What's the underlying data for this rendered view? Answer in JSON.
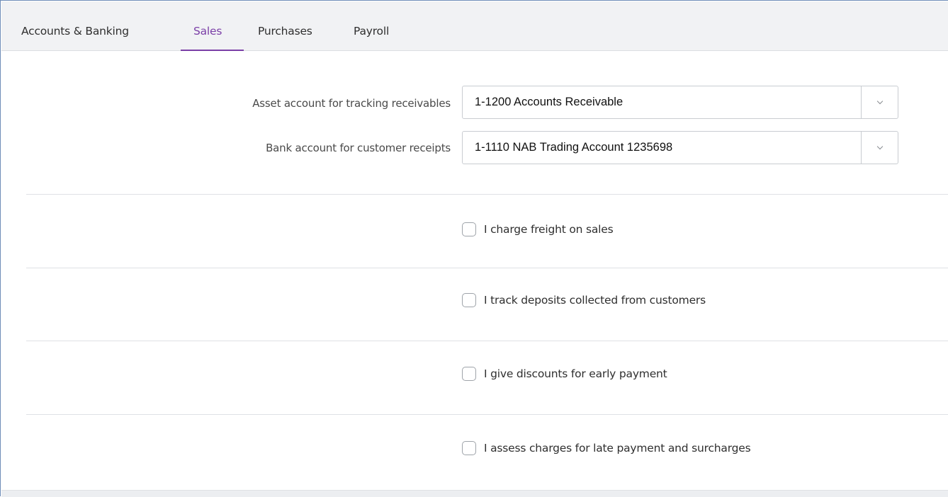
{
  "tabs": [
    {
      "label": "Accounts & Banking",
      "active": false
    },
    {
      "label": "Sales",
      "active": true
    },
    {
      "label": "Purchases",
      "active": false
    },
    {
      "label": "Payroll",
      "active": false
    }
  ],
  "fields": {
    "receivables": {
      "label": "Asset account for tracking receivables",
      "value": "1-1200 Accounts Receivable"
    },
    "receipts": {
      "label": "Bank account for customer receipts",
      "value": "1-1110 NAB Trading Account 1235698"
    }
  },
  "options": [
    {
      "label": "I charge freight on sales",
      "checked": false
    },
    {
      "label": "I track deposits collected from customers",
      "checked": false
    },
    {
      "label": "I give discounts for early payment",
      "checked": false
    },
    {
      "label": "I assess charges for late payment and surcharges",
      "checked": false
    }
  ],
  "icons": {
    "dropdown": "chevron-down-icon"
  },
  "colors": {
    "accent": "#7b3fa7",
    "tabbar_bg": "#f1f2f4",
    "divider": "#dfe1e5"
  }
}
